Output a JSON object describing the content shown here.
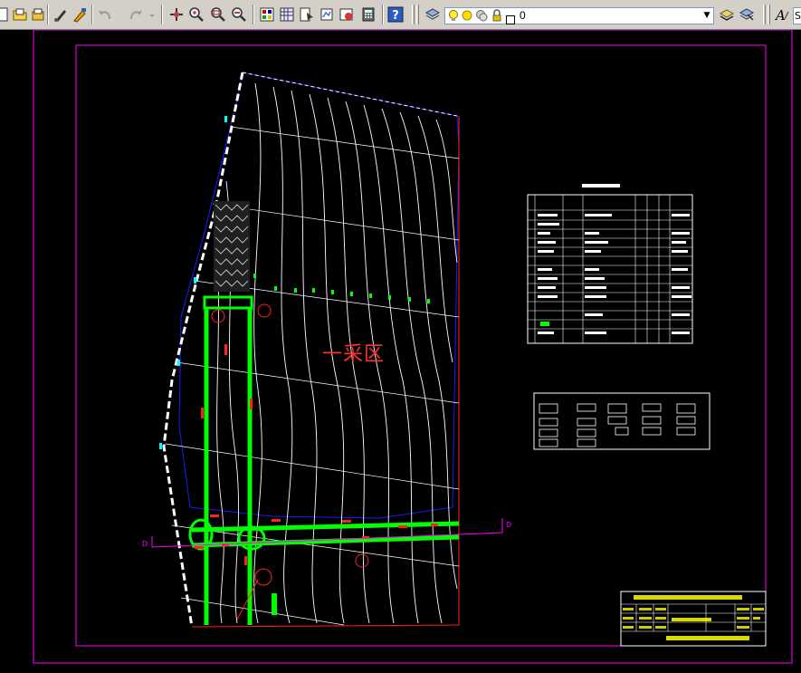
{
  "toolbar": {
    "current_layer": "0",
    "text_style_value": "S",
    "layer_state_icons": [
      "lightbulb-icon",
      "sun-icon",
      "sun-lock-icon",
      "lock-icon",
      "color-square-icon"
    ]
  },
  "drawing": {
    "zone_label": "一采区",
    "section_marker_left": "D",
    "section_marker_right": "D",
    "colors": {
      "background": "#000000",
      "frame": "#ff00ff",
      "boundary": "#ff0000",
      "contours": "#ffffff",
      "roadways": "#00ff00",
      "blue_lines": "#0000ff",
      "dashed_boundary": "#ffffff",
      "points": "#00ffff"
    }
  }
}
